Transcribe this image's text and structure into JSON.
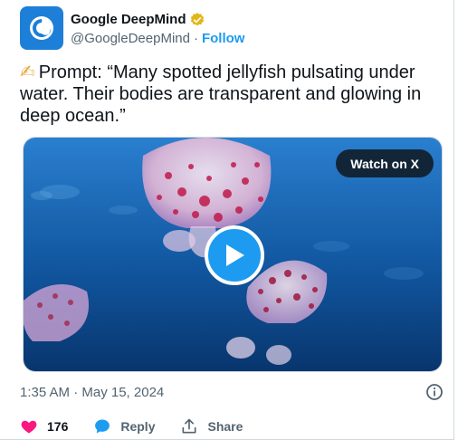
{
  "author": {
    "name": "Google DeepMind",
    "handle": "@GoogleDeepMind",
    "separator": "·",
    "follow_label": "Follow"
  },
  "tweet": {
    "emoji": "✍",
    "text": "Prompt: “Many spotted jellyfish pulsating under water. Their bodies are transparent and glowing in deep ocean.”"
  },
  "media": {
    "watch_label": "Watch on X"
  },
  "meta": {
    "timestamp": "1:35 AM · May 15, 2024"
  },
  "actions": {
    "likes": "176",
    "reply_label": "Reply",
    "share_label": "Share"
  },
  "colors": {
    "accent": "#1d9bf0",
    "like": "#f91880",
    "verified": "#e2b719",
    "avatar_bg": "#1d7fd8"
  },
  "icons": [
    "deepmind-logo-icon",
    "verified-badge-icon",
    "play-icon",
    "info-icon",
    "heart-icon",
    "reply-icon",
    "share-icon"
  ]
}
